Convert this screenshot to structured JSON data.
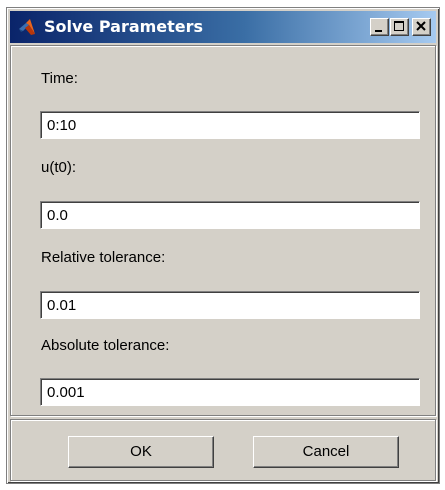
{
  "window": {
    "title": "Solve Parameters",
    "icon": "matlab-icon",
    "controls": [
      "minimize-icon",
      "maximize-icon",
      "close-icon"
    ]
  },
  "fields": [
    {
      "label": "Time:",
      "value": "0:10"
    },
    {
      "label": "u(t0):",
      "value": "0.0"
    },
    {
      "label": "Relative tolerance:",
      "value": "0.01"
    },
    {
      "label": "Absolute tolerance:",
      "value": "0.001"
    }
  ],
  "buttons": {
    "ok_label": "OK",
    "cancel_label": "Cancel"
  },
  "colors": {
    "title_gradient_start": "#0a246a",
    "title_gradient_end": "#a6caf0",
    "face": "#d4d0c8"
  }
}
